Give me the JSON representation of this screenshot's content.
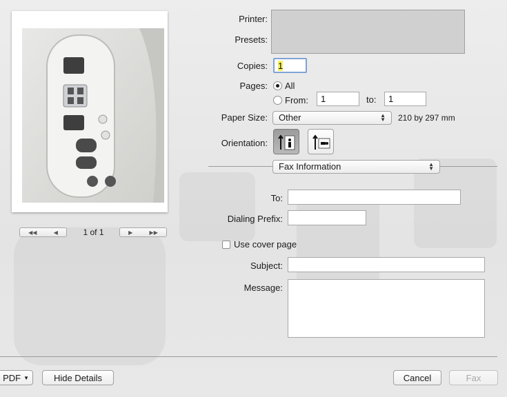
{
  "printer_label": "Printer:",
  "presets_label": "Presets:",
  "copies": {
    "label": "Copies:",
    "value": "1"
  },
  "pages": {
    "label": "Pages:",
    "all_label": "All",
    "from_label": "From:",
    "from_value": "1",
    "to_label": "to:",
    "to_value": "1",
    "selected": "all"
  },
  "paper_size": {
    "label": "Paper Size:",
    "value": "Other",
    "dimensions": "210 by 297 mm"
  },
  "orientation": {
    "label": "Orientation:",
    "selected": "portrait"
  },
  "section_popup": "Fax Information",
  "fax": {
    "to_label": "To:",
    "dialing_prefix_label": "Dialing Prefix:",
    "use_cover_page_label": "Use cover page",
    "use_cover_page_checked": false,
    "subject_label": "Subject:",
    "message_label": "Message:"
  },
  "preview": {
    "page_indicator": "1 of 1"
  },
  "footer": {
    "pdf_label": "PDF",
    "hide_details_label": "Hide Details",
    "cancel_label": "Cancel",
    "fax_label": "Fax"
  }
}
